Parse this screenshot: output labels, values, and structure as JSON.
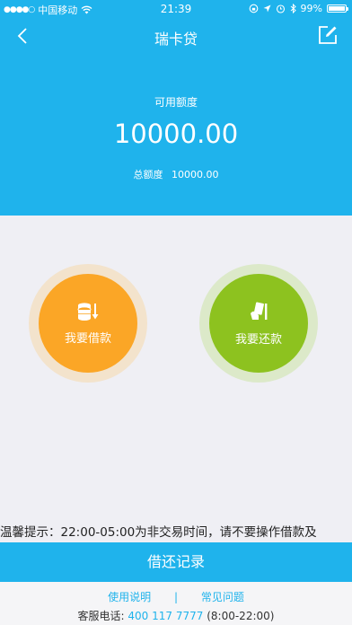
{
  "status_bar": {
    "carrier": "中国移动",
    "time": "21:39",
    "battery": "99%"
  },
  "nav": {
    "title": "瑞卡贷"
  },
  "credit": {
    "available_label": "可用额度",
    "available_value": "10000.00",
    "total_label": "总额度",
    "total_value": "10000.00"
  },
  "actions": {
    "borrow_label": "我要借款",
    "repay_label": "我要还款"
  },
  "notice": {
    "text": "温馨提示：22:00-05:00为非交易时间，请不要操作借款及"
  },
  "record_button": {
    "label": "借还记录"
  },
  "footer": {
    "usage_link": "使用说明",
    "separator": "|",
    "faq_link": "常见问题",
    "service_label": "客服电话:",
    "service_phone": "400 117 7777",
    "service_hours": "(8:00-22:00)"
  },
  "colors": {
    "primary": "#1fb3ec",
    "borrow": "#fba626",
    "repay": "#8dc21f"
  }
}
